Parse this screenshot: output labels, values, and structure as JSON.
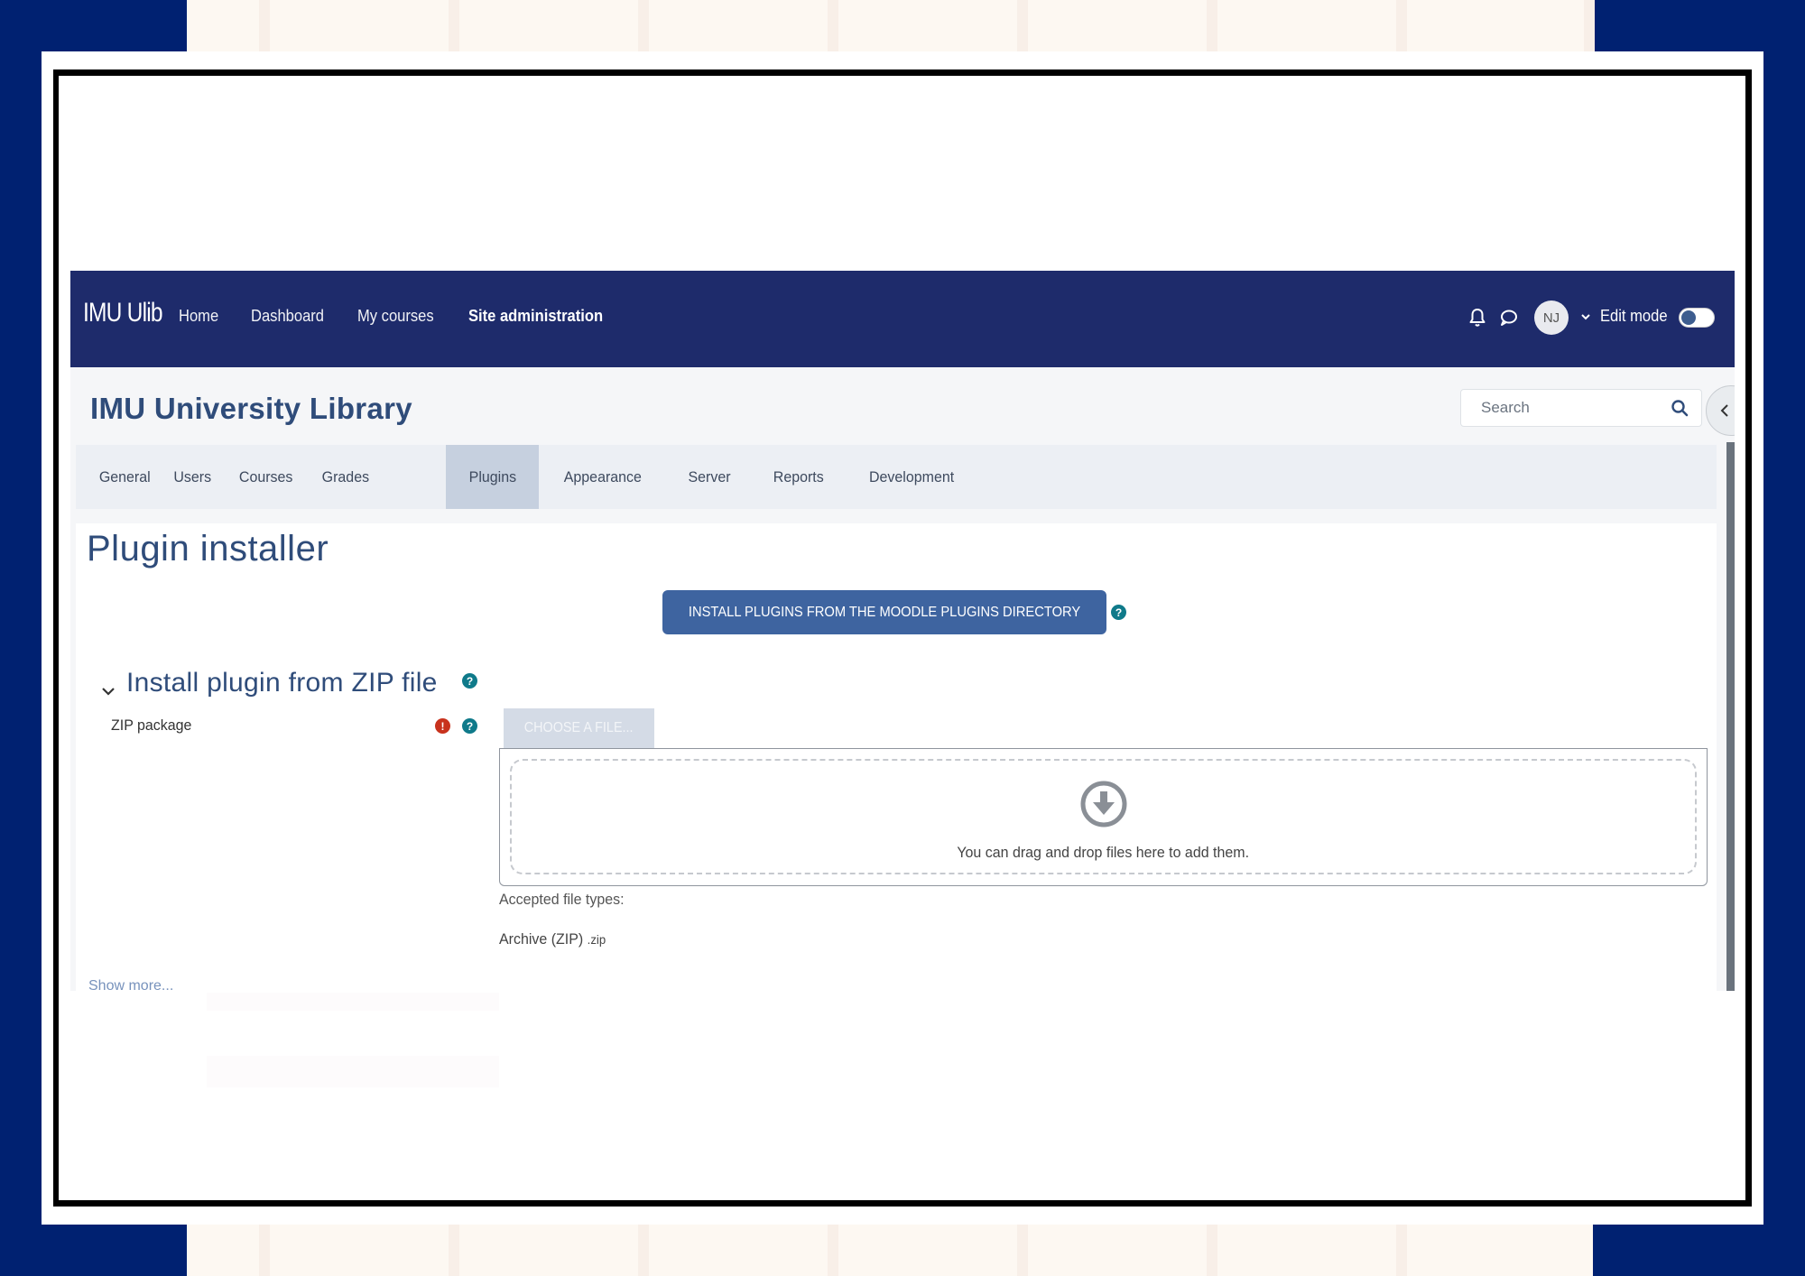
{
  "navbar": {
    "brand": "IMU Ulib",
    "links": [
      {
        "label": "Home",
        "active": false
      },
      {
        "label": "Dashboard",
        "active": false
      },
      {
        "label": "My courses",
        "active": false
      },
      {
        "label": "Site administration",
        "active": true
      }
    ],
    "notifications_icon": "bell-icon",
    "messages_icon": "chat-bubble-icon",
    "user_initials": "NJ",
    "edit_mode_label": "Edit mode",
    "edit_mode_on": false
  },
  "header": {
    "site_title": "IMU University Library",
    "search_placeholder": "Search"
  },
  "tabs": [
    {
      "label": "General",
      "active": false
    },
    {
      "label": "Users",
      "active": false
    },
    {
      "label": "Courses",
      "active": false
    },
    {
      "label": "Grades",
      "active": false
    },
    {
      "label": "Plugins",
      "active": true
    },
    {
      "label": "Appearance",
      "active": false
    },
    {
      "label": "Server",
      "active": false
    },
    {
      "label": "Reports",
      "active": false
    },
    {
      "label": "Development",
      "active": false
    }
  ],
  "page": {
    "title": "Plugin installer",
    "install_directory_button": "INSTALL PLUGINS FROM THE MOODLE PLUGINS DIRECTORY",
    "help_glyph": "?",
    "error_glyph": "!",
    "section": {
      "title": "Install plugin from ZIP file",
      "field_label": "ZIP package",
      "choose_file_button": "CHOOSE A FILE...",
      "dropzone_text": "You can drag and drop files here to add them.",
      "accepted_types_label": "Accepted file types:",
      "accepted_type_name": "Archive (ZIP)",
      "accepted_type_ext": ".zip"
    },
    "show_more": "Show more..."
  },
  "colors": {
    "navbar_bg": "#1e2b6b",
    "primary_button": "#3e64a0",
    "title_text": "#2f4c7a",
    "help_icon": "#0f7a8a",
    "error_icon": "#c8321d",
    "frame_bg": "#002171"
  }
}
